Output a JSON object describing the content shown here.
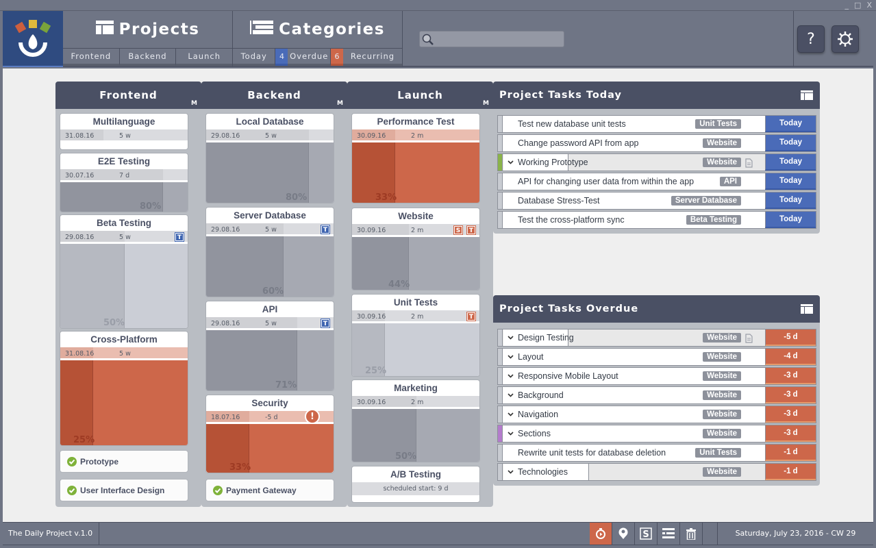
{
  "window": {
    "controls": [
      "_",
      "□",
      "X"
    ]
  },
  "header": {
    "projects_label": "Projects",
    "categories_label": "Categories",
    "project_tabs": [
      "Frontend",
      "Backend",
      "Launch"
    ],
    "category_tabs": [
      {
        "label": "Today",
        "count": "4"
      },
      {
        "label": "Overdue",
        "count": "6"
      },
      {
        "label": "Recurring"
      }
    ],
    "search": {
      "value": "",
      "placeholder": ""
    },
    "help_label": "?",
    "colors": {
      "accent_blue": "#4a6bb8",
      "accent_red": "#cd674a",
      "header_bg": "#6f7585",
      "panel_head": "#4a5064"
    }
  },
  "columns": [
    {
      "title": "Frontend",
      "marker": "M",
      "cards": [
        {
          "title": "Multilanguage",
          "date": "31.08.16",
          "duration": "5 w",
          "style": "empty"
        },
        {
          "title": "E2E Testing",
          "date": "30.07.16",
          "duration": "7 d",
          "progress": "80%",
          "style": "dark"
        },
        {
          "title": "Beta Testing",
          "date": "29.08.16",
          "duration": "5 w",
          "progress": "50%",
          "style": "light",
          "tags": [
            "T"
          ]
        },
        {
          "title": "Cross-Platform",
          "date": "31.08.16",
          "duration": "5 w",
          "progress": "25%",
          "style": "red"
        }
      ],
      "milestones": [
        "Prototype",
        "User Interface Design"
      ]
    },
    {
      "title": "Backend",
      "marker": "M",
      "cards": [
        {
          "title": "Local Database",
          "date": "29.08.16",
          "duration": "5 w",
          "progress": "80%",
          "style": "dark"
        },
        {
          "title": "Server Database",
          "date": "29.08.16",
          "duration": "5 w",
          "progress": "60%",
          "style": "dark",
          "tags": [
            "T"
          ]
        },
        {
          "title": "API",
          "date": "29.08.16",
          "duration": "5 w",
          "progress": "71%",
          "style": "dark",
          "tags": [
            "T"
          ]
        },
        {
          "title": "Security",
          "date": "18.07.16",
          "duration": "-5 d",
          "progress": "33%",
          "style": "red",
          "warning": "!"
        }
      ],
      "milestones": [
        "Payment Gateway"
      ]
    },
    {
      "title": "Launch",
      "marker": "M",
      "cards": [
        {
          "title": "Performance Test",
          "date": "30.09.16",
          "duration": "2 m",
          "progress": "33%",
          "style": "red"
        },
        {
          "title": "Website",
          "date": "30.09.16",
          "duration": "2 m",
          "progress": "44%",
          "style": "dark",
          "tags": [
            "S",
            "T"
          ]
        },
        {
          "title": "Unit Tests",
          "date": "30.09.16",
          "duration": "2 m",
          "progress": "25%",
          "style": "light",
          "tags": [
            "T"
          ]
        },
        {
          "title": "Marketing",
          "date": "30.09.16",
          "duration": "2 m",
          "progress": "50%",
          "style": "dark"
        },
        {
          "title": "A/B Testing",
          "scheduled": "scheduled start: 9 d",
          "style": "scheduled"
        }
      ]
    }
  ],
  "today_panel": {
    "title": "Project Tasks Today",
    "rows": [
      {
        "name": "Test new database unit tests",
        "tag": "Unit Tests",
        "due": "Today"
      },
      {
        "name": "Change password API from app",
        "tag": "Website",
        "due": "Today"
      },
      {
        "name": "Working Prototype",
        "tag": "Website",
        "due": "Today",
        "expand": true,
        "doc": true,
        "stripe": "#8ab34a",
        "progress": 0.25
      },
      {
        "name": "API for changing user data from within the app",
        "tag": "API",
        "due": "Today"
      },
      {
        "name": "Database Stress-Test",
        "tag": "Server Database",
        "due": "Today"
      },
      {
        "name": "Test the cross-platform sync",
        "tag": "Beta Testing",
        "due": "Today"
      }
    ]
  },
  "overdue_panel": {
    "title": "Project Tasks Overdue",
    "rows": [
      {
        "name": "Design Testing",
        "tag": "Website",
        "due": "-5 d",
        "expand": true,
        "doc": true,
        "progress": 0.25
      },
      {
        "name": "Layout",
        "tag": "Website",
        "due": "-4 d",
        "expand": true
      },
      {
        "name": "Responsive Mobile Layout",
        "tag": "Website",
        "due": "-3 d",
        "expand": true
      },
      {
        "name": "Background",
        "tag": "Website",
        "due": "-3 d",
        "expand": true
      },
      {
        "name": "Navigation",
        "tag": "Website",
        "due": "-3 d",
        "expand": true
      },
      {
        "name": "Sections",
        "tag": "Website",
        "due": "-3 d",
        "expand": true,
        "stripe": "#b47ccc"
      },
      {
        "name": "Rewrite unit tests for database deletion",
        "tag": "Unit Tests",
        "due": "-1 d"
      },
      {
        "name": "Technologies",
        "tag": "Website",
        "due": "-1 d",
        "expand": true,
        "progress": 0.33
      }
    ]
  },
  "footer": {
    "version": "The Daily Project v.1.0",
    "icons": [
      "stopwatch-icon",
      "location-icon",
      "s-icon",
      "list-icon",
      "trash-icon"
    ],
    "date": "Saturday, July 23, 2016 - CW 29"
  }
}
